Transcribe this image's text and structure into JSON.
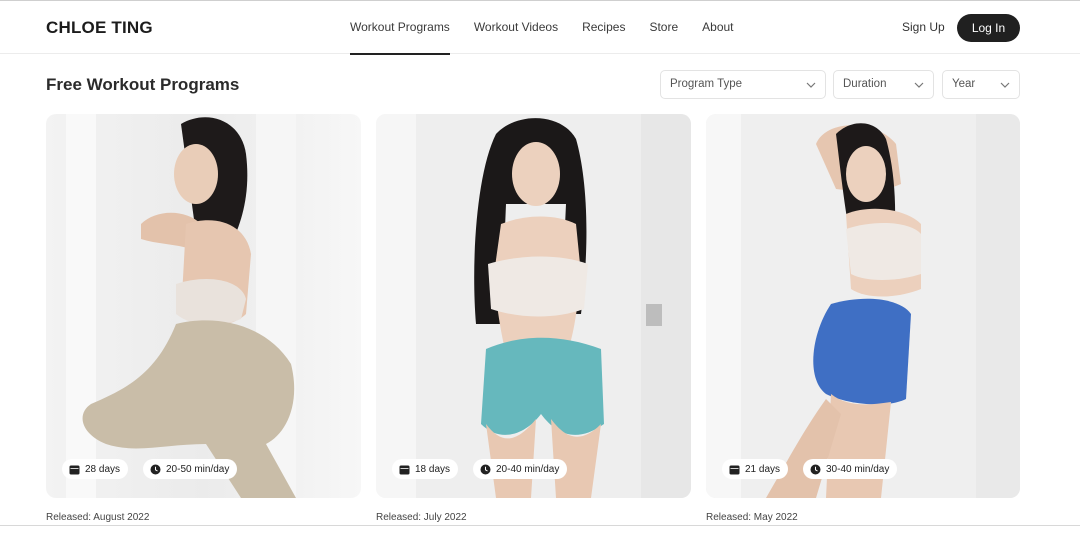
{
  "brand": "CHLOE TING",
  "nav": [
    {
      "label": "Workout Programs",
      "active": true
    },
    {
      "label": "Workout Videos",
      "active": false
    },
    {
      "label": "Recipes",
      "active": false
    },
    {
      "label": "Store",
      "active": false
    },
    {
      "label": "About",
      "active": false
    }
  ],
  "auth": {
    "signup": "Sign Up",
    "login": "Log In"
  },
  "page_title": "Free Workout Programs",
  "filters": {
    "program_type": "Program Type",
    "duration": "Duration",
    "year": "Year"
  },
  "programs": [
    {
      "days": "28 days",
      "time": "20-50 min/day",
      "released": "Released: August 2022",
      "outfit_color": "#c9bda8"
    },
    {
      "days": "18 days",
      "time": "20-40 min/day",
      "released": "Released: July 2022",
      "outfit_color": "#66b8bd"
    },
    {
      "days": "21 days",
      "time": "30-40 min/day",
      "released": "Released: May 2022",
      "outfit_color": "#3f6fc4"
    }
  ],
  "icons": {
    "calendar": "calendar-icon",
    "clock": "clock-icon",
    "chevron": "chevron-down-icon"
  },
  "colors": {
    "login_bg": "#202020",
    "badge_bg": "#ffffff"
  }
}
